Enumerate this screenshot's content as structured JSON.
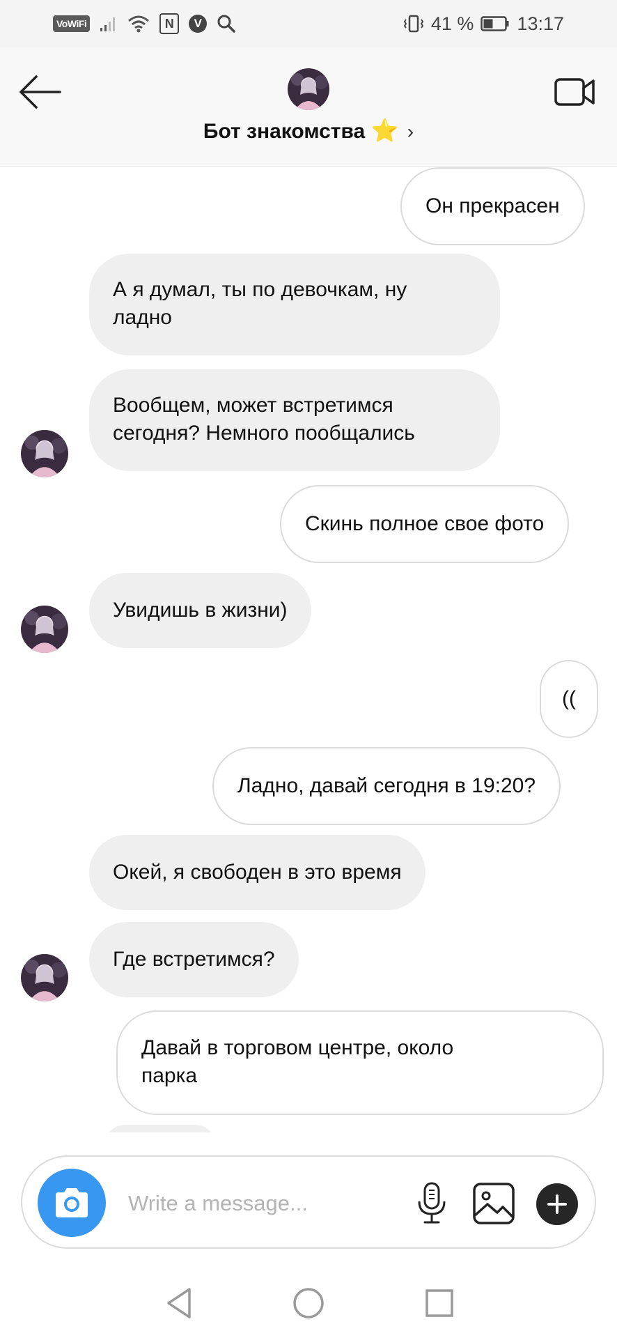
{
  "status_bar": {
    "vowifi_label": "VoWiFi",
    "nfc_label": "N",
    "v_label": "V",
    "battery_text": "41 %",
    "time": "13:17"
  },
  "header": {
    "title": "Бот знакомства",
    "title_emoji": "⭐",
    "chevron": "›"
  },
  "messages": [
    {
      "direction": "out",
      "text": "Он прекрасен"
    },
    {
      "direction": "in",
      "text": "А я думал, ты по девочкам, ну\nладно"
    },
    {
      "direction": "in",
      "text": "Вообщем, может встретимся\nсегодня? Немного пообщались",
      "avatar": true
    },
    {
      "direction": "out",
      "text": "Скинь полное свое фото"
    },
    {
      "direction": "in",
      "text": "Увидишь в жизни)",
      "avatar": true
    },
    {
      "direction": "out",
      "text": "(("
    },
    {
      "direction": "out",
      "text": "Ладно, давай сегодня в 19:20?"
    },
    {
      "direction": "in",
      "text": "Окей, я свободен в это время"
    },
    {
      "direction": "in",
      "text": "Где встретимся?",
      "avatar": true
    },
    {
      "direction": "out",
      "text": "Давай в торговом центре, около\nпарка"
    }
  ],
  "composer": {
    "placeholder": "Write a message..."
  },
  "icons": {
    "back": "back-arrow-icon",
    "video": "video-call-icon",
    "camera": "camera-icon",
    "mic": "microphone-icon",
    "gallery": "gallery-icon",
    "plus": "plus-icon",
    "nav_back": "nav-back-icon",
    "nav_home": "nav-home-icon",
    "nav_recent": "nav-recent-icon"
  },
  "colors": {
    "camera_button": "#3897f0",
    "incoming_bubble": "#efefef",
    "star": "#f5b800"
  }
}
